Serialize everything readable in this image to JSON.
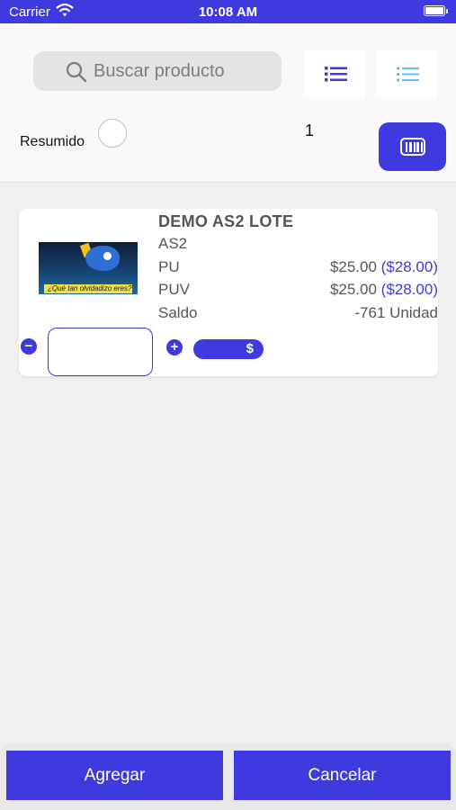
{
  "status_bar": {
    "carrier": "Carrier",
    "time": "10:08 AM"
  },
  "search": {
    "placeholder": "Buscar producto",
    "icon": "search-icon"
  },
  "view_toggles": [
    {
      "icon": "list-icon"
    },
    {
      "icon": "list-detailed-icon"
    }
  ],
  "summary": {
    "label": "Resumido",
    "checked": false
  },
  "item_count": "1",
  "scanner": {
    "icon": "barcode-icon"
  },
  "product": {
    "name": "DEMO AS2 LOTE",
    "code": "AS2",
    "image_caption": "¿Qué tan olvidadizo eres?",
    "pu": {
      "label": "PU",
      "price": "$25.00",
      "alt_price": "($28.00)"
    },
    "puv": {
      "label": "PUV",
      "price": "$25.00",
      "alt_price": "($28.00)"
    },
    "saldo": {
      "label": "Saldo",
      "value": "-761 Unidad"
    },
    "quantity": "",
    "price_symbol": "$"
  },
  "footer": {
    "add_label": "Agregar",
    "cancel_label": "Cancelar"
  },
  "colors": {
    "accent": "#3f3ae0",
    "background": "#f0f0f0"
  }
}
